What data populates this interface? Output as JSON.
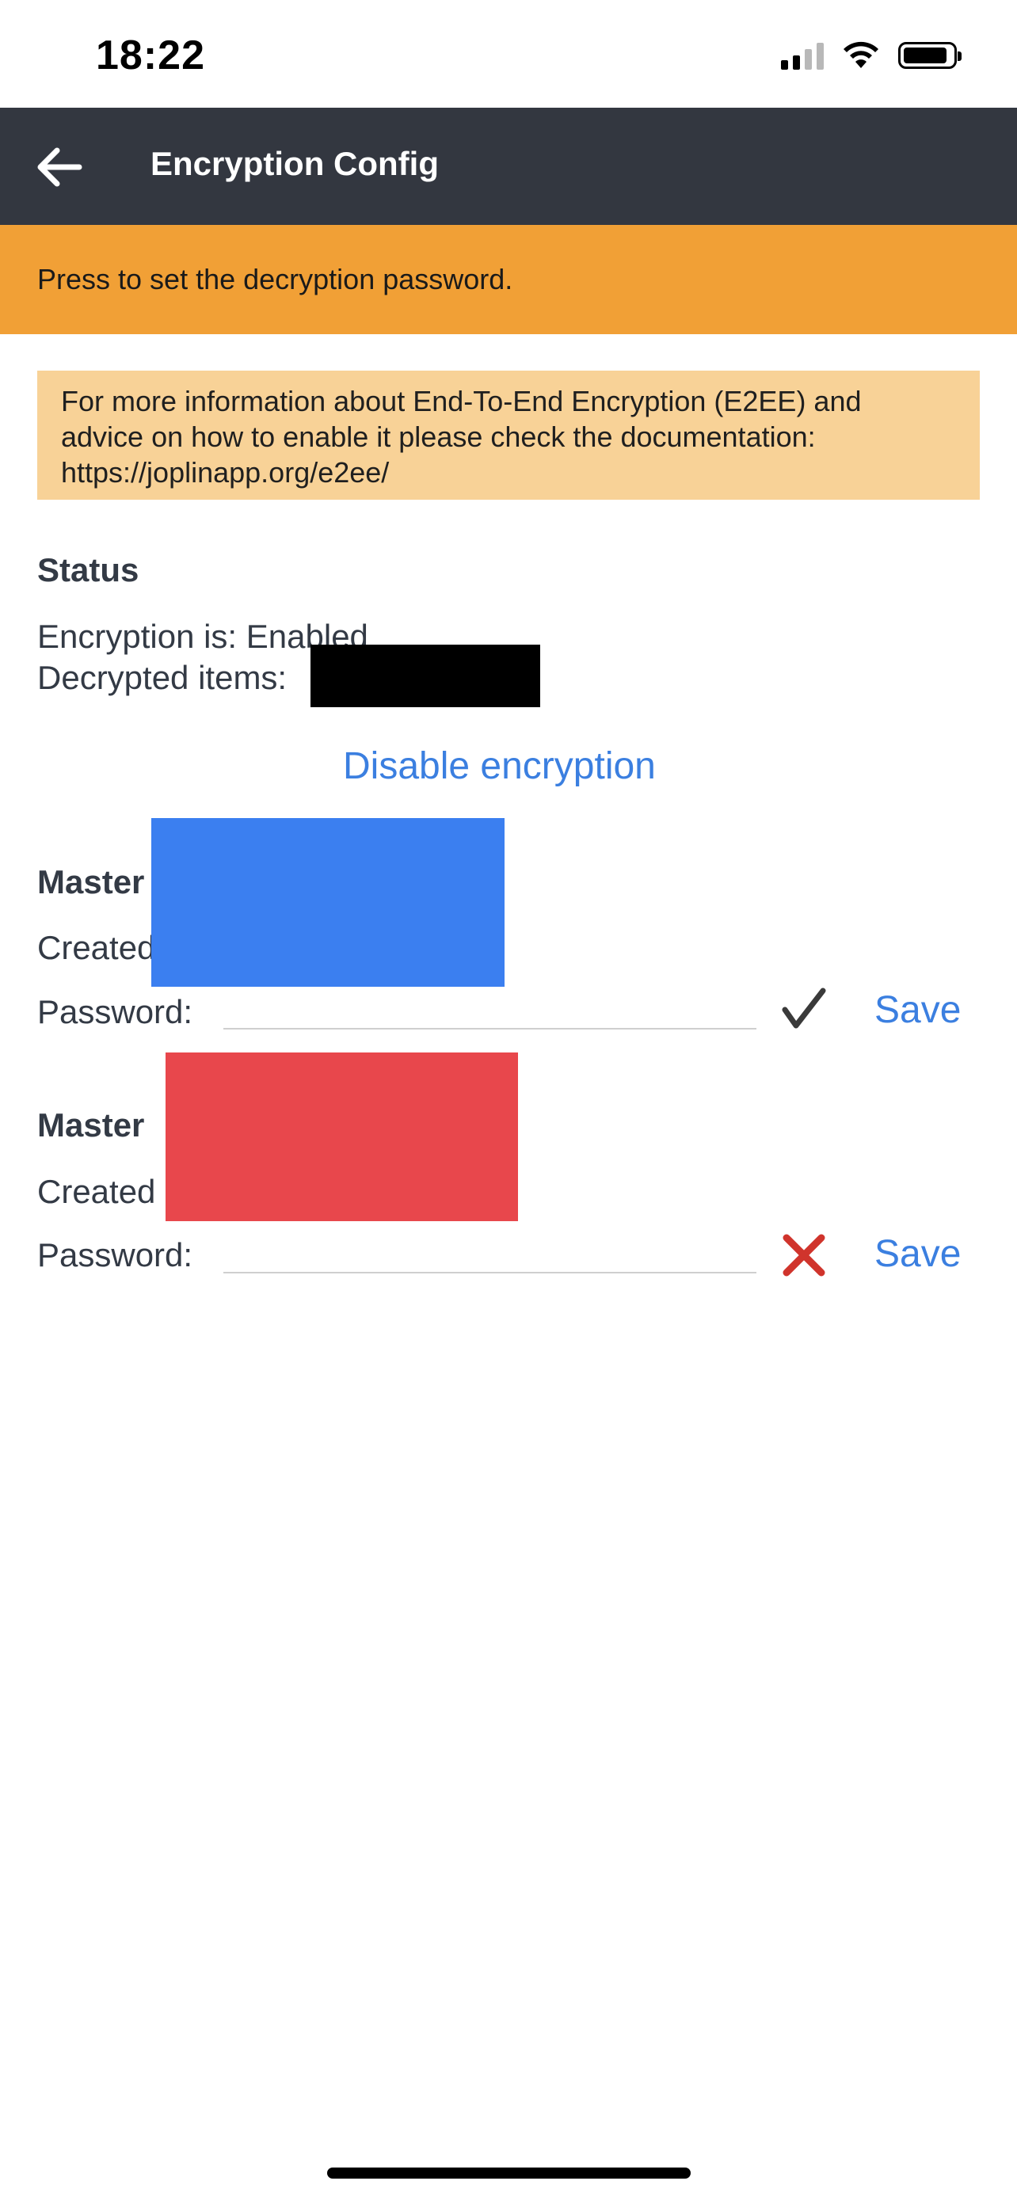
{
  "status_bar": {
    "time": "18:22"
  },
  "header": {
    "title": "Encryption Config"
  },
  "banner": {
    "text": "Press to set the decryption password."
  },
  "info": {
    "line1": "For more information about End-To-End Encryption (E2EE) and",
    "line2": "advice on how to enable it please check the documentation:",
    "line3": "https://joplinapp.org/e2ee/"
  },
  "status": {
    "heading": "Status",
    "encryption_text": "Encryption is: Enabled",
    "decrypted_label": "Decrypted items:"
  },
  "disable_label": "Disable encryption",
  "master_keys": [
    {
      "title": "Master",
      "created_label": "Created",
      "password_label": "Password:",
      "status_icon": "check-icon",
      "save_label": "Save"
    },
    {
      "title": "Master",
      "created_label": "Created",
      "password_label": "Password:",
      "status_icon": "cross-icon",
      "save_label": "Save"
    }
  ],
  "colors": {
    "header_bg": "#333740",
    "banner_bg": "#f1a036",
    "info_bg": "#f8d297",
    "link": "#3b7fe0",
    "error": "#d0342c"
  }
}
